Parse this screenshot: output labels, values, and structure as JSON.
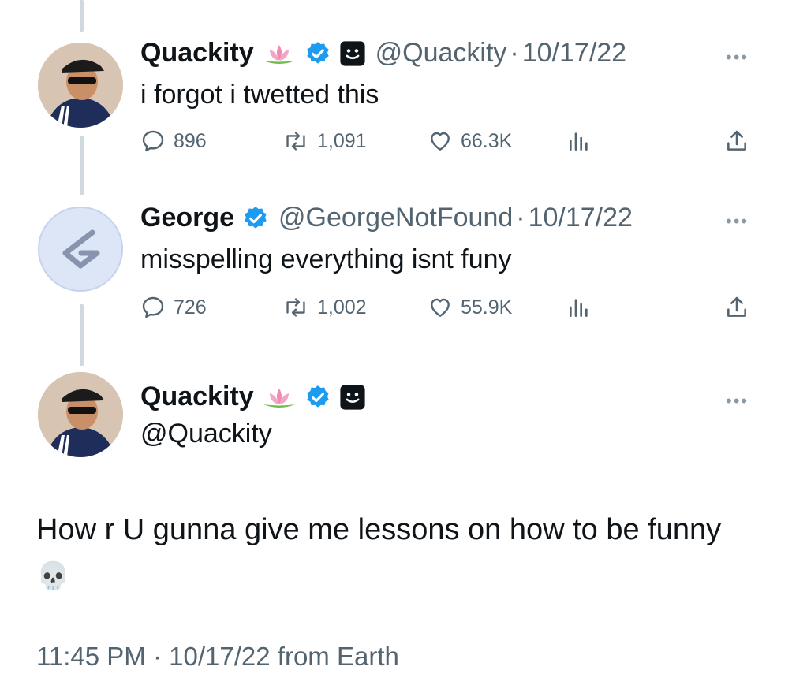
{
  "tweets": [
    {
      "name": "Quackity",
      "handle": "@Quackity",
      "date": "10/17/22",
      "text": "i forgot i twetted this",
      "replies": "896",
      "retweets": "1,091",
      "likes": "66.3K"
    },
    {
      "name": "George",
      "handle": "@GeorgeNotFound",
      "date": "10/17/22",
      "text": "misspelling everything isnt funy",
      "replies": "726",
      "retweets": "1,002",
      "likes": "55.9K"
    }
  ],
  "main": {
    "name": "Quackity",
    "handle": "@Quackity",
    "text": "How r U gunna give me lessons on how to be funny",
    "emoji": "💀",
    "time": "11:45 PM",
    "date": "10/17/22",
    "source": "from Earth"
  },
  "separator": "·",
  "more_label": "•••",
  "icons": {
    "verified": "verified-badge-icon",
    "lotus": "lotus-emoji-icon",
    "smiley": "smiley-square-icon",
    "reply": "reply-icon",
    "retweet": "retweet-icon",
    "like": "heart-icon",
    "views": "views-icon",
    "share": "share-icon",
    "more": "more-icon"
  },
  "colors": {
    "verified": "#1d9bf0",
    "text": "#0f1419",
    "secondary": "#536471"
  }
}
